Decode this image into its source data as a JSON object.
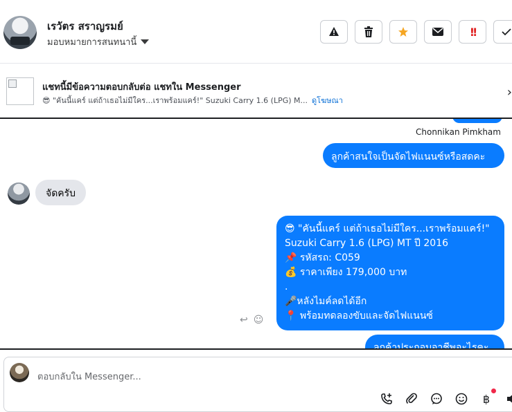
{
  "header": {
    "contact_name": "เรวัตร สราญรมย์",
    "assign_label": "มอบหมายการสนทนานี้",
    "actions": [
      "report-icon",
      "trash-icon",
      "star-icon",
      "envelope-icon",
      "priority-icon",
      "check-icon"
    ],
    "priority_glyph": "!!"
  },
  "ad": {
    "title": "แชทนี้มีข้อความตอบกลับต่อ แชทใน Messenger",
    "emoji": "😎",
    "snippet": "\"คันนี้แคร์ แต่ถ้าเธอไม่มีใคร...เราพร้อมแคร์!\" Suzuki Carry 1.6 (LPG) M...",
    "link": "ดูโฆษณา"
  },
  "chat": {
    "sender_name": "Chonnikan Pimkham",
    "msg_out_1": "ลูกค้าสนใจเป็นจัดไฟแนนซ์หรือสดคะ",
    "msg_in_1": "จัดครับ",
    "msg_out_2": {
      "line1": "😎 \"คันนี้แคร์ แต่ถ้าเธอไม่มีใคร...เราพร้อมแคร์!\"",
      "line2": "Suzuki Carry 1.6 (LPG) MT ปี 2016",
      "line3": "📌 รหัสรถ: C059",
      "line4": "💰 ราคาเพียง 179,000 บาท",
      "line5": ".",
      "line6": "🎤หลังไมค์ลดได้อีก",
      "line7": "📍 พร้อมทดลองขับและจัดไฟแนนซ์"
    },
    "msg_out_3": "ลูกค้าประกอบอาชีพอะไรคะ",
    "reply_glyph": "↩",
    "react_glyph": "☺"
  },
  "composer": {
    "placeholder": "ตอบกลับใน Messenger...",
    "baht_glyph": "฿",
    "tools": [
      "call-add-icon",
      "attachment-icon",
      "chat-bubble-icon",
      "emoji-icon",
      "baht-icon",
      "speaker-icon"
    ]
  },
  "colors": {
    "accent": "#0a7cff",
    "incoming": "#e4e6eb",
    "star": "#f5a623",
    "priority": "#e02020"
  }
}
